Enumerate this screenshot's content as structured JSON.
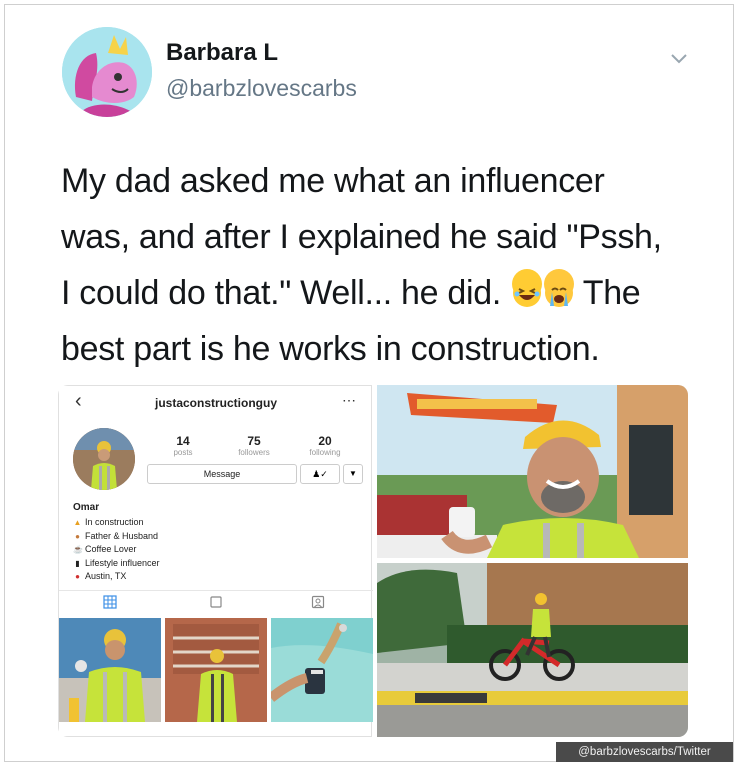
{
  "tweet": {
    "author_name": "Barbara L",
    "author_handle": "@barbzlovescarbs",
    "text_lines": [
      "My dad asked me what an influencer",
      "was, and after I explained he said \"Pssh,",
      "I could do that.\" Well... he did.",
      " The",
      "best part is he works in construction."
    ]
  },
  "instagram": {
    "username": "justaconstructionguy",
    "stats": [
      {
        "value": "14",
        "label": "posts"
      },
      {
        "value": "75",
        "label": "followers"
      },
      {
        "value": "20",
        "label": "following"
      }
    ],
    "message_label": "Message",
    "bio_name": "Omar",
    "bio_lines": [
      {
        "icon": "construction-worker-icon",
        "text": "In construction"
      },
      {
        "icon": "family-icon",
        "text": "Father & Husband"
      },
      {
        "icon": "coffee-icon",
        "text": "Coffee Lover"
      },
      {
        "icon": "phone-icon",
        "text": "Lifestyle influencer"
      },
      {
        "icon": "pin-icon",
        "text": "Austin, TX"
      }
    ]
  },
  "watermark": "@barbzlovescarbs/Twitter",
  "colors": {
    "handle": "#657786",
    "text": "#14171a",
    "vest": "#c6e33a",
    "hardhat": "#f2c230"
  }
}
